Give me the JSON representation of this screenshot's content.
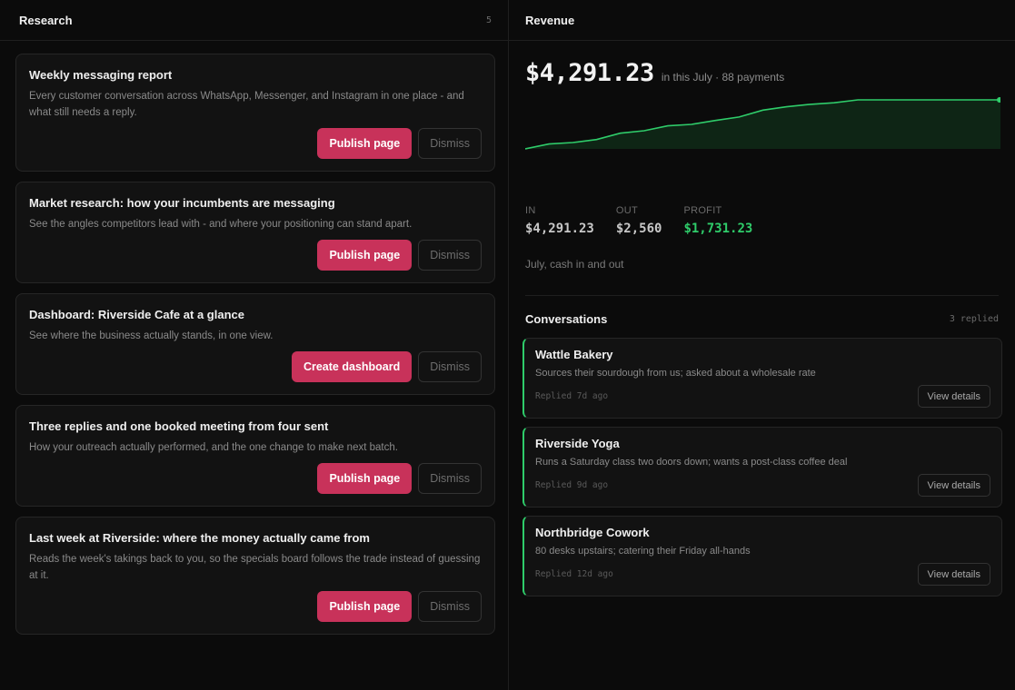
{
  "research": {
    "title": "Research",
    "count": "5",
    "cards": [
      {
        "title": "Weekly messaging report",
        "desc": "Every customer conversation across WhatsApp, Messenger, and Instagram in one place - and what still needs a reply.",
        "primary": "Publish page",
        "secondary": "Dismiss"
      },
      {
        "title": "Market research: how your incumbents are messaging",
        "desc": "See the angles competitors lead with - and where your positioning can stand apart.",
        "primary": "Publish page",
        "secondary": "Dismiss"
      },
      {
        "title": "Dashboard: Riverside Cafe at a glance",
        "desc": "See where the business actually stands, in one view.",
        "primary": "Create dashboard",
        "secondary": "Dismiss"
      },
      {
        "title": "Three replies and one booked meeting from four sent",
        "desc": "How your outreach actually performed, and the one change to make next batch.",
        "primary": "Publish page",
        "secondary": "Dismiss"
      },
      {
        "title": "Last week at Riverside: where the money actually came from",
        "desc": "Reads the week's takings back to you, so the specials board follows the trade instead of guessing at it.",
        "primary": "Publish page",
        "secondary": "Dismiss"
      }
    ]
  },
  "revenue": {
    "title": "Revenue",
    "amount": "$4,291.23",
    "subtitle": "in this July · 88 payments",
    "trend": [
      0,
      0.1,
      0.13,
      0.19,
      0.32,
      0.37,
      0.47,
      0.5,
      0.58,
      0.65,
      0.79,
      0.86,
      0.91,
      0.94,
      1,
      1,
      1,
      1,
      1,
      1,
      1
    ],
    "stats": {
      "in_label": "IN",
      "in_value": "$4,291.23",
      "out_label": "OUT",
      "out_value": "$2,560",
      "profit_label": "PROFIT",
      "profit_value": "$1,731.23"
    },
    "caption": "July, cash in and out",
    "colors": {
      "accent": "#2fcc6a",
      "primary_button": "#c8325a"
    }
  },
  "conversations": {
    "title": "Conversations",
    "count": "3 replied",
    "items": [
      {
        "name": "Wattle Bakery",
        "desc": "Sources their sourdough from us; asked about a wholesale rate",
        "time": "Replied 7d ago",
        "action": "View details"
      },
      {
        "name": "Riverside Yoga",
        "desc": "Runs a Saturday class two doors down; wants a post-class coffee deal",
        "time": "Replied 9d ago",
        "action": "View details"
      },
      {
        "name": "Northbridge Cowork",
        "desc": "80 desks upstairs; catering their Friday all-hands",
        "time": "Replied 12d ago",
        "action": "View details"
      }
    ]
  }
}
